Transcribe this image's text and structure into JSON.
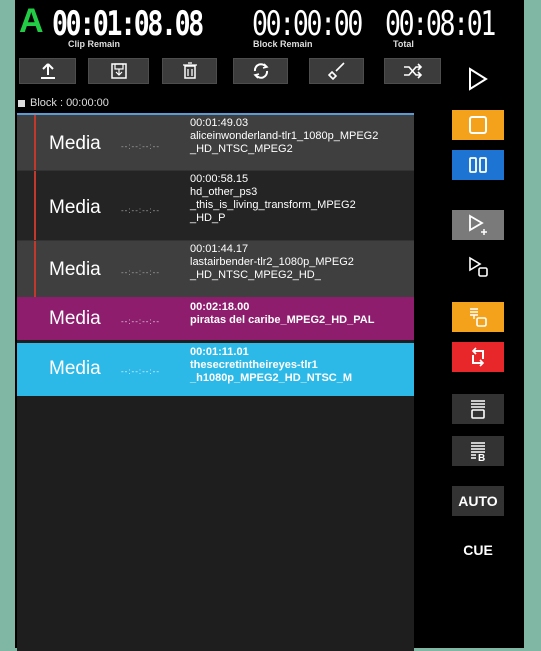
{
  "header": {
    "channel": "A",
    "clip_remain": "00:01:08.08",
    "clip_remain_label": "Clip Remain",
    "block_remain": "00:00:00",
    "block_remain_label": "Block Remain",
    "total": "00:08:01",
    "total_label": "Total"
  },
  "toolbar": [
    "upload-icon",
    "save-icon",
    "trash-icon",
    "refresh-icon",
    "brush-icon",
    "shuffle-icon"
  ],
  "block": {
    "label": "Block : 00:00:00"
  },
  "playlist": [
    {
      "media": "Media",
      "dots": "--:--:--:--",
      "time": "00:01:49.03",
      "lines": [
        "aliceinwonderland-tlr1_1080p_MPEG2",
        "_HD_NTSC_MPEG2"
      ],
      "style": "gray"
    },
    {
      "media": "Media",
      "dots": "--:--:--:--",
      "time": "00:00:58.15",
      "lines": [
        "hd_other_ps3",
        "_this_is_living_transform_MPEG2",
        "_HD_P"
      ],
      "style": "dark"
    },
    {
      "media": "Media",
      "dots": "--:--:--:--",
      "time": "00:01:44.17",
      "lines": [
        "lastairbender-tlr2_1080p_MPEG2",
        "_HD_NTSC_MPEG2_HD_"
      ],
      "style": "gray"
    },
    {
      "media": "Media",
      "dots": "--:--:--:--",
      "time": "00:02:18.00",
      "lines": [
        "piratas del caribe_MPEG2_HD_PAL"
      ],
      "style": "magenta"
    },
    {
      "media": "Media",
      "dots": "--:--:--:--",
      "time": "00:01:11.01",
      "lines": [
        "thesecretintheireyes-tlr1",
        "_h1080p_MPEG2_HD_NTSC_M"
      ],
      "style": "cyan"
    }
  ],
  "side": {
    "auto_label": "AUTO",
    "cue_label": "CUE"
  },
  "colors": {
    "green": "#22cc44",
    "orange": "#f4a11c",
    "blue": "#1e74d2",
    "red": "#e8272b",
    "magenta": "#8e1d6e",
    "cyan": "#2db9e8"
  }
}
